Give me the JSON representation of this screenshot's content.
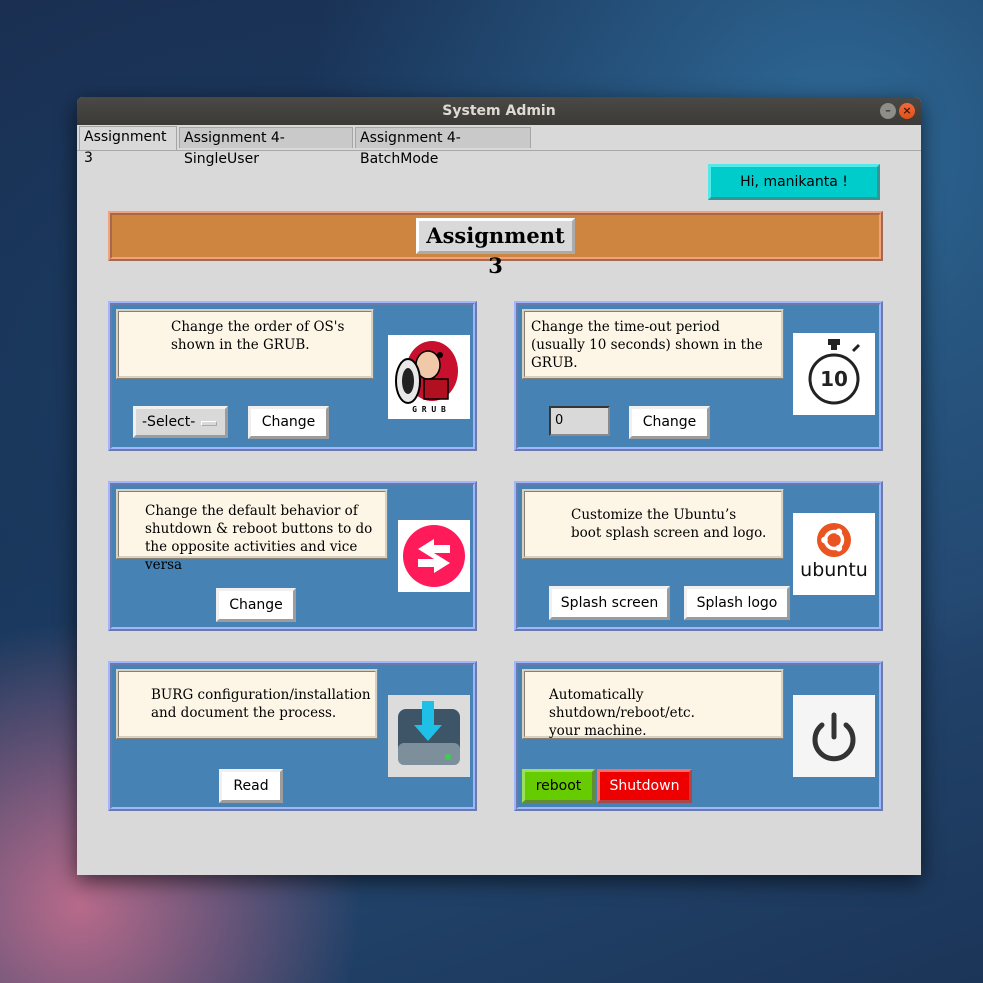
{
  "window": {
    "title": "System Admin"
  },
  "tabs": [
    {
      "label": "Assignment 3"
    },
    {
      "label": "Assignment 4-SingleUser"
    },
    {
      "label": "Assignment 4-BatchMode"
    }
  ],
  "greeting": "Hi, manikanta !",
  "page_title": "Assignment 3",
  "cards": {
    "grub_order": {
      "desc": "Change the order of OS's\nshown in the GRUB.",
      "select_value": "-Select-",
      "button": "Change",
      "icon": "grub-logo-icon",
      "icon_text": "G R U B"
    },
    "grub_timeout": {
      "desc": "Change the time-out period\n(usually 10 seconds) shown in the GRUB.",
      "input_value": "0",
      "button": "Change",
      "icon": "stopwatch-icon",
      "icon_text": "10"
    },
    "power_swap": {
      "desc": "Change the default behavior of\nshutdown & reboot buttons to do\nthe opposite activities and vice versa",
      "button": "Change",
      "icon": "swap-arrows-icon"
    },
    "splash": {
      "desc": "Customize the Ubuntu’s\nboot splash screen and logo.",
      "button1": "Splash screen",
      "button2": "Splash logo",
      "icon": "ubuntu-logo-icon",
      "icon_text": "ubuntu"
    },
    "burg": {
      "desc": "BURG configuration/installation\nand document the process.",
      "button": "Read",
      "icon": "download-drive-icon"
    },
    "auto_power": {
      "desc": "Automatically shutdown/reboot/etc.\nyour machine.",
      "button_reboot": "reboot",
      "button_shutdown": "Shutdown",
      "icon": "power-icon"
    }
  },
  "colors": {
    "card_bg": "#4682b4",
    "banner": "#cd853f",
    "greeting_bg": "#00cccc",
    "reboot_bg": "#66cc00",
    "shutdown_bg": "#ee0000"
  }
}
